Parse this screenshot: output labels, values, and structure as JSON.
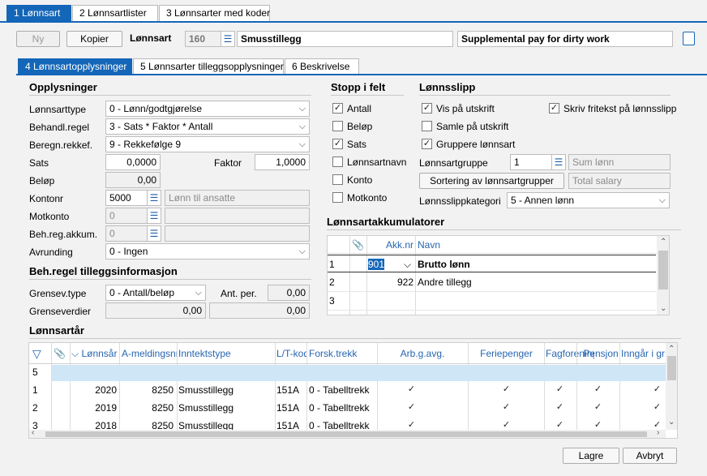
{
  "top_tabs": [
    {
      "label": "1 Lønnsart"
    },
    {
      "label": "2 Lønnsartlister"
    },
    {
      "label": "3 Lønnsarter med koder"
    }
  ],
  "toolbar": {
    "new_label": "Ny",
    "copy_label": "Kopier",
    "wagetype_label": "Lønnsart",
    "wagetype_no": "160",
    "wagetype_name": "Smusstillegg",
    "wagetype_name_en": "Supplemental pay for dirty work"
  },
  "sub_tabs": [
    {
      "label": "4 Lønnsartopplysninger"
    },
    {
      "label": "5 Lønnsarter tilleggsopplysninger"
    },
    {
      "label": "6 Beskrivelse"
    }
  ],
  "opplysninger": {
    "title": "Opplysninger",
    "lonnsarttype_label": "Lønnsarttype",
    "lonnsarttype_value": "0 - Lønn/godtgjørelse",
    "behandl_label": "Behandl.regel",
    "behandl_value": "3 - Sats * Faktor * Antall",
    "beregn_label": "Beregn.rekkef.",
    "beregn_value": "9 - Rekkefølge 9",
    "sats_label": "Sats",
    "sats_value": "0,0000",
    "faktor_label": "Faktor",
    "faktor_value": "1,0000",
    "belop_label": "Beløp",
    "belop_value": "0,00",
    "kontonr_label": "Kontonr",
    "kontonr_value": "5000",
    "kontonr_desc": "Lønn til ansatte",
    "motkonto_label": "Motkonto",
    "motkonto_value": "0",
    "behreg_label": "Beh.reg.akkum.",
    "behreg_value": "0",
    "avrunding_label": "Avrunding",
    "avrunding_value": "0 - Ingen"
  },
  "tillegg": {
    "title": "Beh.regel tilleggsinformasjon",
    "grensev_label": "Grensev.type",
    "grensev_value": "0 - Antall/beløp",
    "antper_label": "Ant. per.",
    "antper_value": "0,00",
    "grenseverdier_label": "Grenseverdier",
    "grense1": "0,00",
    "grense2": "0,00"
  },
  "stopp": {
    "title": "Stopp i felt",
    "items": [
      {
        "label": "Antall",
        "checked": "✓"
      },
      {
        "label": "Beløp",
        "checked": ""
      },
      {
        "label": "Sats",
        "checked": "✓"
      },
      {
        "label": "Lønnsartnavn",
        "checked": ""
      },
      {
        "label": "Konto",
        "checked": ""
      },
      {
        "label": "Motkonto",
        "checked": ""
      }
    ]
  },
  "lonnsslipp": {
    "title": "Lønnsslipp",
    "vis_label": "Vis på utskrift",
    "vis_checked": "✓",
    "samle_label": "Samle på utskrift",
    "samle_checked": "",
    "grupp_label": "Gruppere lønnsart",
    "grupp_checked": "✓",
    "fritekst_label": "Skriv fritekst på lønnsslipp",
    "fritekst_checked": "✓",
    "gruppe_label": "Lønnsartgruppe",
    "gruppe_value": "1",
    "gruppe_desc": "Sum lønn",
    "sortering_label": "Sortering av lønnsartgrupper",
    "sortering_desc": "Total salary",
    "kategori_label": "Lønnsslippkategori",
    "kategori_value": "5 - Annen lønn"
  },
  "akkum": {
    "title": "Lønnsartakkumulatorer",
    "col_akknr": "Akk.nr",
    "col_navn": "Navn",
    "rows": [
      {
        "n": "1",
        "akk": "901",
        "navn": "Brutto lønn"
      },
      {
        "n": "2",
        "akk": "922",
        "navn": "Andre tillegg"
      },
      {
        "n": "3",
        "akk": "",
        "navn": ""
      }
    ]
  },
  "lonnsartar": {
    "title": "Lønnsartår",
    "headers": [
      "Lønnsår",
      "A-meldingsnr",
      "Inntektstype",
      "L/T-kod",
      "Forsk.trekk",
      "Arb.g.avg.",
      "Feriepenger",
      "Fagforening",
      "Pensjon",
      "Inngår i gr"
    ],
    "new_row_no": "5",
    "rows": [
      {
        "n": "1",
        "year": "2020",
        "am": "8250",
        "type": "Smusstillegg",
        "lt": "151A",
        "trekk": "0 - Tabelltrekk"
      },
      {
        "n": "2",
        "year": "2019",
        "am": "8250",
        "type": "Smusstillegg",
        "lt": "151A",
        "trekk": "0 - Tabelltrekk"
      },
      {
        "n": "3",
        "year": "2018",
        "am": "8250",
        "type": "Smusstillegg",
        "lt": "151A",
        "trekk": "0 - Tabelltrekk"
      }
    ],
    "check": "✓"
  },
  "footer": {
    "save_label": "Lagre",
    "cancel_label": "Avbryt"
  },
  "colors": {
    "accent": "#1466b8",
    "selected_row": "#cfe6f7"
  }
}
